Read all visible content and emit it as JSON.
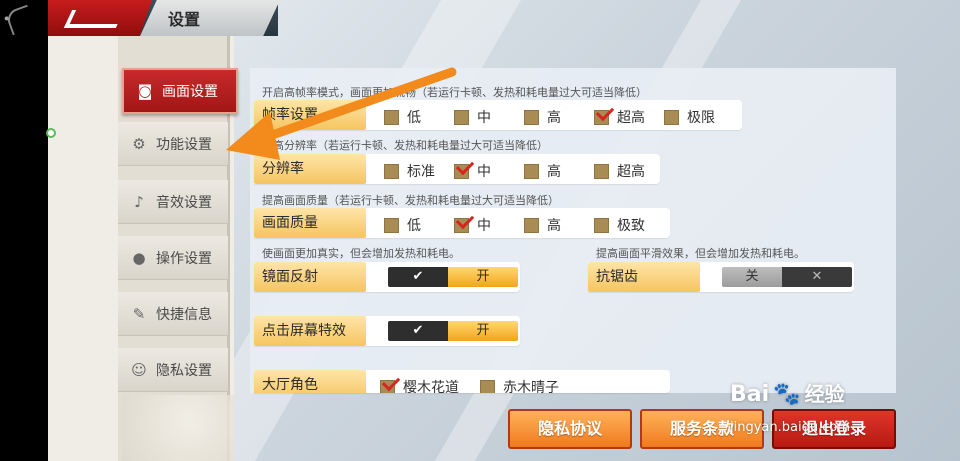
{
  "header": {
    "title": "设置"
  },
  "sidebar": {
    "items": [
      {
        "label": "画面设置",
        "icon": "camera-icon",
        "active": true
      },
      {
        "label": "功能设置",
        "icon": "gear-icon",
        "active": false
      },
      {
        "label": "音效设置",
        "icon": "music-note-icon",
        "active": false
      },
      {
        "label": "操作设置",
        "icon": "joystick-icon",
        "active": false
      },
      {
        "label": "快捷信息",
        "icon": "edit-icon",
        "active": false
      },
      {
        "label": "隐私设置",
        "icon": "chat-bubble-icon",
        "active": false
      }
    ]
  },
  "settings": {
    "frame_rate": {
      "desc": "开启高帧率模式，画面更加流畅（若运行卡顿、发热和耗电量过大可适当降低）",
      "label": "帧率设置",
      "options": [
        "低",
        "中",
        "高",
        "超高",
        "极限"
      ],
      "selected": "超高"
    },
    "resolution": {
      "desc": "提高分辨率（若运行卡顿、发热和耗电量过大可适当降低）",
      "label": "分辨率",
      "options": [
        "标准",
        "中",
        "高",
        "超高"
      ],
      "selected": "中"
    },
    "quality": {
      "desc": "提高画面质量（若运行卡顿、发热和耗电量过大可适当降低）",
      "label": "画面质量",
      "options": [
        "低",
        "中",
        "高",
        "极致"
      ],
      "selected": "中"
    },
    "reflection": {
      "desc": "使画面更加真实，但会增加发热和耗电。",
      "label": "镜面反射",
      "on_label": "开",
      "value": "on"
    },
    "antialias": {
      "desc": "提高画面平滑效果，但会增加发热和耗电。",
      "label": "抗锯齿",
      "off_label": "关",
      "value": "off"
    },
    "tap_effect": {
      "label": "点击屏幕特效",
      "on_label": "开",
      "value": "on"
    },
    "lobby_role": {
      "label": "大厅角色",
      "options": [
        "樱木花道",
        "赤木晴子"
      ],
      "selected": "樱木花道"
    }
  },
  "footer": {
    "privacy_label": "隐私协议",
    "terms_label": "服务条款",
    "logout_label": "退出登录"
  },
  "watermark": {
    "logo": "Bai",
    "cn": "经验",
    "url": "jingyan.baidu.com"
  },
  "colors": {
    "accent_red": "#c82a2a",
    "label_gold": "#f5c560",
    "button_orange": "#f07a1d",
    "check_red": "#d6261e"
  }
}
